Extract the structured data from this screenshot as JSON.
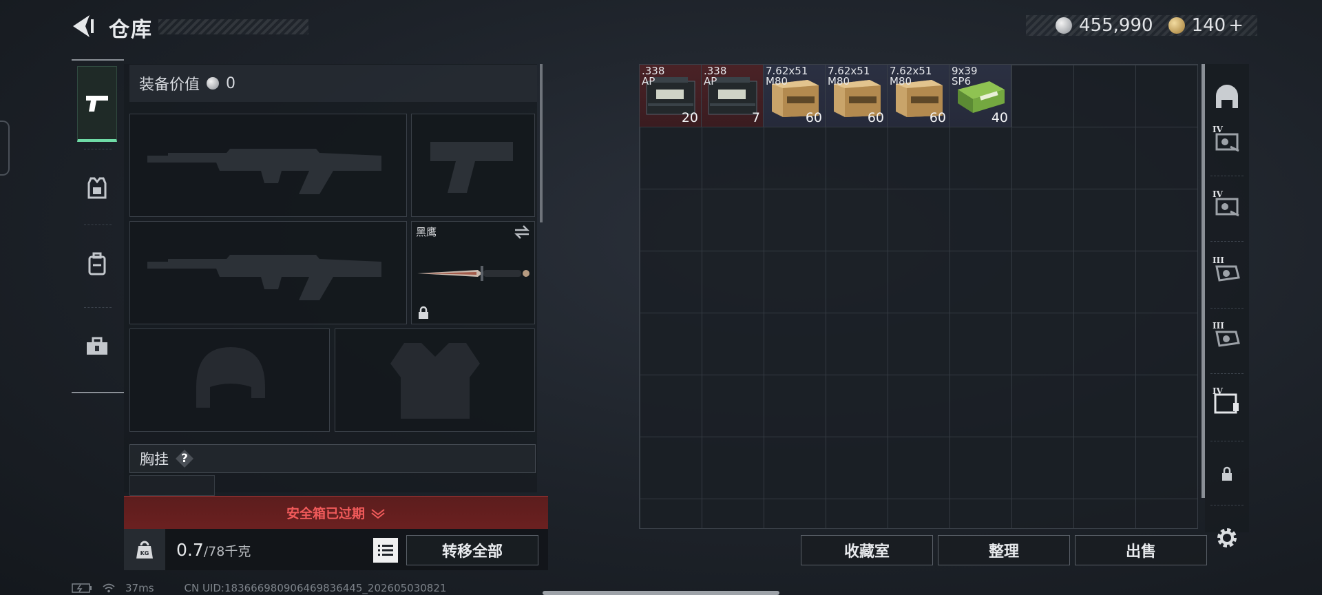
{
  "header": {
    "title": "仓库"
  },
  "currency": {
    "silver_value": "455,990",
    "gold_value": "140",
    "gold_plus": "+"
  },
  "equipment": {
    "value_label": "装备价值",
    "value": "0",
    "melee_name": "黑鹰",
    "chest_rig_label": "胸挂",
    "help_label": "?"
  },
  "safe_box": {
    "warning": "安全箱已过期"
  },
  "weight": {
    "current": "0.7",
    "max": "/78千克",
    "kg_label": "KG"
  },
  "actions": {
    "transfer_all": "转移全部",
    "collection": "收藏室",
    "sort": "整理",
    "sell": "出售"
  },
  "stash_items": [
    {
      "name": ".338\nAP",
      "count": "20",
      "kind": "ammo-can",
      "tint": "red"
    },
    {
      "name": ".338\nAP",
      "count": "7",
      "kind": "ammo-can",
      "tint": "red"
    },
    {
      "name": "7.62x51\nM80",
      "count": "60",
      "kind": "ammo-box",
      "tint": "blue"
    },
    {
      "name": "7.62x51\nM80",
      "count": "60",
      "kind": "ammo-box",
      "tint": "blue"
    },
    {
      "name": "7.62x51\nM80",
      "count": "60",
      "kind": "ammo-box",
      "tint": "blue"
    },
    {
      "name": "9x39\nSP6",
      "count": "40",
      "kind": "ammo-green",
      "tint": "blue"
    }
  ],
  "right_categories": [
    {
      "icon": "helmet-cabinet-icon",
      "tier": ""
    },
    {
      "icon": "tier-iv-armor-icon",
      "tier": "IV"
    },
    {
      "icon": "tier-iv-armor-icon",
      "tier": "IV"
    },
    {
      "icon": "tier-iii-armor-icon",
      "tier": "III"
    },
    {
      "icon": "tier-iii-armor-icon",
      "tier": "III"
    },
    {
      "icon": "tier-iv-ammo-case-icon",
      "tier": "IV"
    },
    {
      "icon": "lock-icon",
      "tier": ""
    }
  ],
  "status": {
    "ping": "37ms",
    "uid": "CN UID:183666980906469836445_202605030821"
  },
  "colors": {
    "accent_green": "#6fdba6",
    "warning_red": "#f05a5a",
    "warning_bg": "#6b2020"
  }
}
